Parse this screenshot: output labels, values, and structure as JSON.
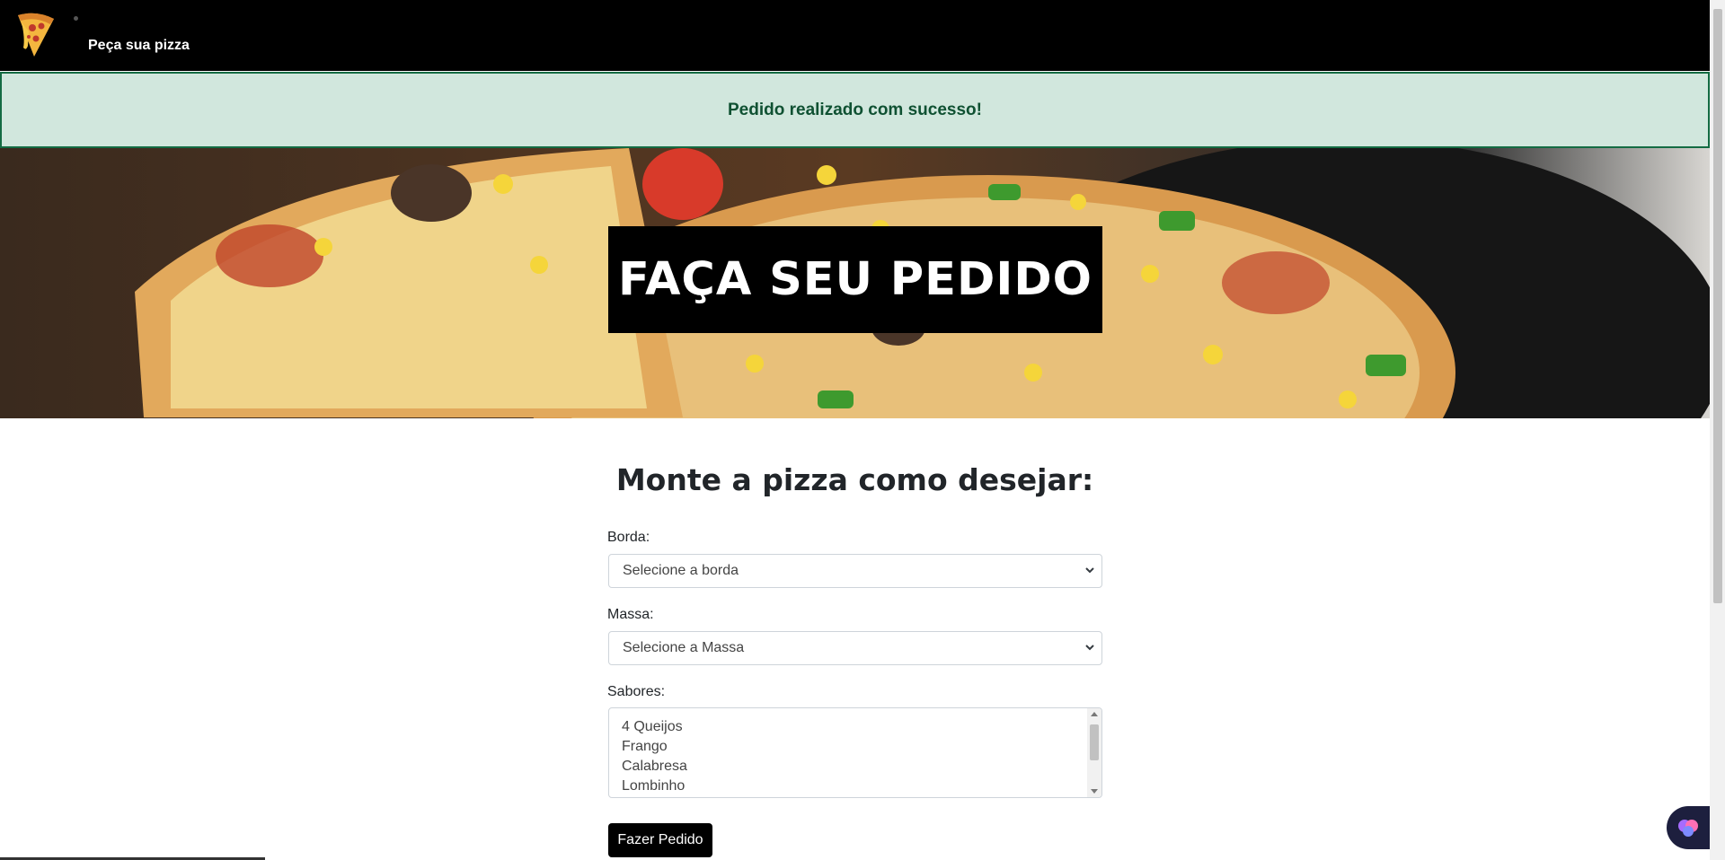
{
  "navbar": {
    "brand": "Peça sua pizza",
    "logo_icon": "pizza-slice-icon"
  },
  "alert": {
    "message": "Pedido realizado com sucesso!",
    "color": "#0f5132",
    "background": "#d1e7dd"
  },
  "hero": {
    "title": "FAÇA SEU PEDIDO"
  },
  "form": {
    "heading": "Monte a pizza como desejar:",
    "borda": {
      "label": "Borda:",
      "selected": "Selecione a borda"
    },
    "massa": {
      "label": "Massa:",
      "selected": "Selecione a Massa"
    },
    "sabores": {
      "label": "Sabores:",
      "options": [
        "4 Queijos",
        "Frango",
        "Calabresa",
        "Lombinho"
      ]
    },
    "submit_label": "Fazer Pedido"
  },
  "colors": {
    "navbar": "#000000",
    "button": "#000000",
    "accent_success": "#146c43"
  }
}
